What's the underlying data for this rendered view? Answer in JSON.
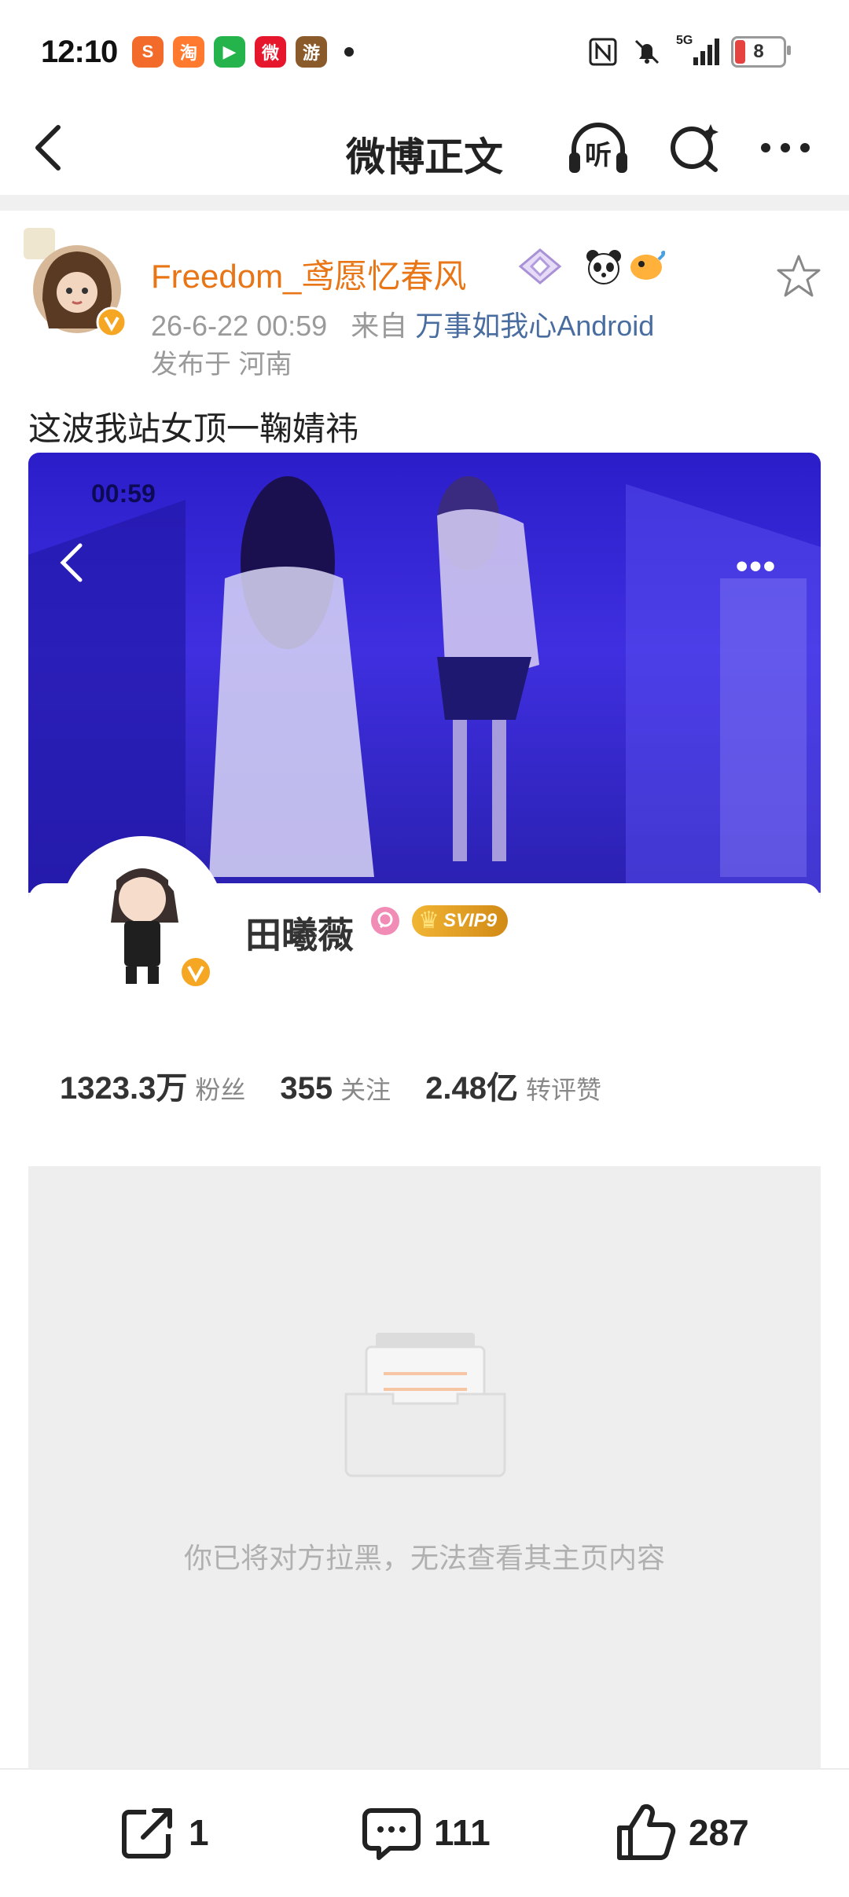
{
  "status_bar": {
    "time": "12:10",
    "apps": [
      {
        "icon": "sogou-icon",
        "glyph": "S",
        "color": "#f26b2a"
      },
      {
        "icon": "taobao-icon",
        "glyph": "淘",
        "color": "#ff7a2f"
      },
      {
        "icon": "video-app-icon",
        "glyph": "▶",
        "color": "#25b34c"
      },
      {
        "icon": "weibo-icon",
        "glyph": "微",
        "color": "#e6162d"
      },
      {
        "icon": "game-icon",
        "glyph": "游",
        "color": "#8a5a2b"
      }
    ],
    "network": "5G",
    "battery": "8"
  },
  "nav": {
    "title": "微博正文",
    "listen_label": "听"
  },
  "post": {
    "author": "Freedom_鸢愿忆春风",
    "time": "26-6-22 00:59",
    "source_prefix": "来自",
    "source": "万事如我心Android",
    "location": "发布于 河南",
    "text": "这波我站女顶一鞠婧祎"
  },
  "embedded": {
    "video_time": "00:59",
    "more": "•••",
    "profile_name": "田曦薇",
    "svip": "SVIP9",
    "stats": [
      {
        "value": "1323.3万",
        "label": "粉丝"
      },
      {
        "value": "355",
        "label": "关注"
      },
      {
        "value": "2.48亿",
        "label": "转评赞"
      }
    ],
    "blocked_message": "你已将对方拉黑，无法查看其主页内容"
  },
  "actions": {
    "repost_count": "1",
    "comment_count": "111",
    "like_count": "287"
  },
  "colors": {
    "author": "#e87516",
    "source_link": "#4a6da0",
    "video_bg": "#3f2fe0",
    "verified": "#f5a623"
  }
}
